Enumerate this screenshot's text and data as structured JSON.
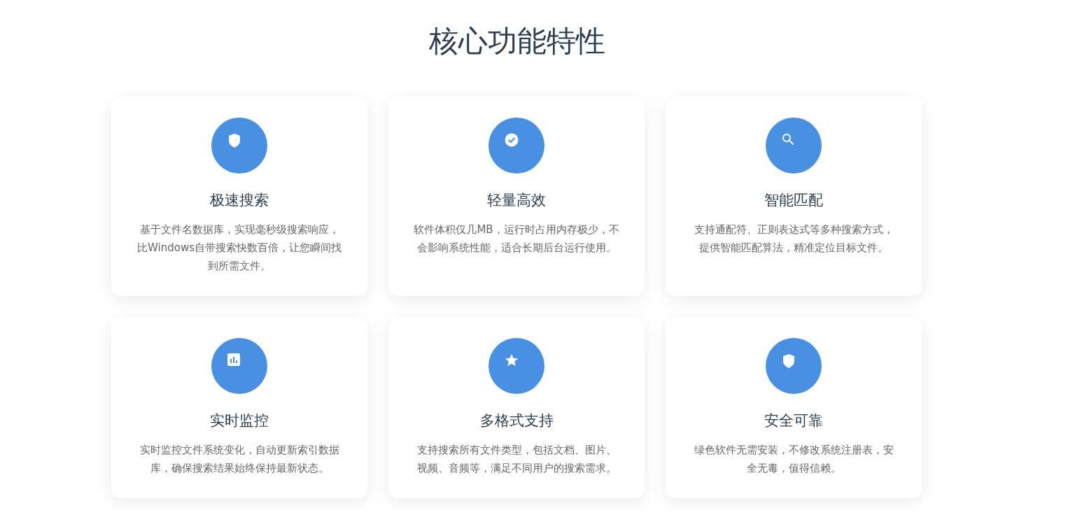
{
  "heading": "核心功能特性",
  "features": [
    {
      "kind": "shield",
      "title": "极速搜索",
      "description": "基于文件名数据库，实现毫秒级搜索响应，比Windows自带搜索快数百倍，让您瞬间找到所需文件。"
    },
    {
      "kind": "check",
      "title": "轻量高效",
      "description": "软件体积仅几MB，运行时占用内存极少，不会影响系统性能，适合长期后台运行使用。"
    },
    {
      "kind": "search",
      "title": "智能匹配",
      "description": "支持通配符、正则表达式等多种搜索方式，提供智能匹配算法，精准定位目标文件。"
    },
    {
      "kind": "chart",
      "title": "实时监控",
      "description": "实时监控文件系统变化，自动更新索引数据库，确保搜索结果始终保持最新状态。"
    },
    {
      "kind": "star",
      "title": "多格式支持",
      "description": "支持搜索所有文件类型，包括文档、图片、视频、音频等，满足不同用户的搜索需求。"
    },
    {
      "kind": "shield",
      "title": "安全可靠",
      "description": "绿色软件无需安装，不修改系统注册表，安全无毒，值得信赖。"
    }
  ]
}
